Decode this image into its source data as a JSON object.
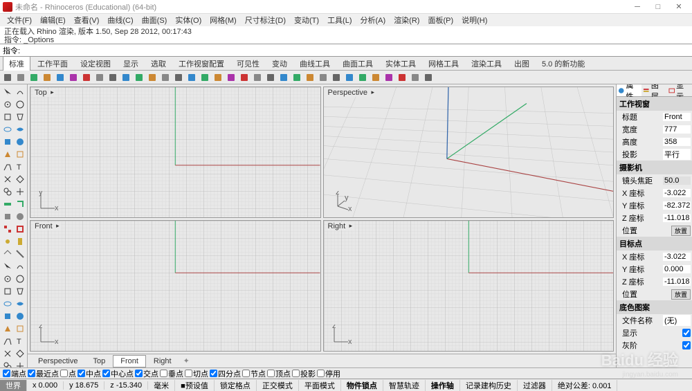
{
  "titlebar": {
    "title": "未命名 - Rhinoceros (Educational) (64-bit)"
  },
  "menubar": [
    "文件(F)",
    "编辑(E)",
    "查看(V)",
    "曲线(C)",
    "曲面(S)",
    "实体(O)",
    "网格(M)",
    "尺寸标注(D)",
    "变动(T)",
    "工具(L)",
    "分析(A)",
    "渲染(R)",
    "面板(P)",
    "说明(H)"
  ],
  "info": {
    "line1": "正在载入 Rhino 渲染, 版本 1.50, Sep 28 2012, 00:17:43",
    "line2": "指令: _Options"
  },
  "cmd": {
    "label": "指令:"
  },
  "tabs": [
    "标准",
    "工作平面",
    "设定视图",
    "显示",
    "选取",
    "工作视窗配置",
    "可见性",
    "变动",
    "曲线工具",
    "曲面工具",
    "实体工具",
    "网格工具",
    "渲染工具",
    "出图",
    "5.0 的新功能"
  ],
  "viewports": {
    "top": "Top",
    "persp": "Perspective",
    "front": "Front",
    "right": "Right"
  },
  "viewtabs": [
    "Perspective",
    "Top",
    "Front",
    "Right"
  ],
  "rpanel": {
    "tabs": [
      "属性",
      "图层",
      "显示"
    ],
    "sections": {
      "workview": "工作视窗",
      "camera": "摄影机",
      "target": "目标点",
      "wallpaper": "底色图案"
    },
    "props": {
      "title_l": "标题",
      "title_v": "Front",
      "width_l": "宽度",
      "width_v": "777",
      "height_l": "高度",
      "height_v": "358",
      "proj_l": "投影",
      "proj_v": "平行",
      "focal_l": "镜头焦距",
      "focal_v": "50.0",
      "cx_l": "X 座标",
      "cx_v": "-3.022",
      "cy_l": "Y 座标",
      "cy_v": "-82.372",
      "cz_l": "Z 座标",
      "cz_v": "-11.018",
      "pos_l": "位置",
      "pos_btn": "放置",
      "tx_l": "X 座标",
      "tx_v": "-3.022",
      "ty_l": "Y 座标",
      "ty_v": "0.000",
      "tz_l": "Z 座标",
      "tz_v": "-11.018",
      "tpos_l": "位置",
      "tpos_btn": "放置",
      "fname_l": "文件名称",
      "fname_v": "(无)",
      "show_l": "显示",
      "gray_l": "灰阶"
    }
  },
  "osnap": [
    {
      "l": "端点",
      "c": true
    },
    {
      "l": "最近点",
      "c": true
    },
    {
      "l": "点",
      "c": false
    },
    {
      "l": "中点",
      "c": true
    },
    {
      "l": "中心点",
      "c": true
    },
    {
      "l": "交点",
      "c": true
    },
    {
      "l": "垂点",
      "c": false
    },
    {
      "l": "切点",
      "c": false
    },
    {
      "l": "四分点",
      "c": true
    },
    {
      "l": "节点",
      "c": false
    },
    {
      "l": "顶点",
      "c": false
    },
    {
      "l": "投影",
      "c": false
    },
    {
      "l": "停用",
      "c": false
    }
  ],
  "status": {
    "world": "世界",
    "x": "x 0.000",
    "y": "y 18.675",
    "z": "z -15.340",
    "unit": "毫米",
    "default": "■预设值",
    "snap": "锁定格点",
    "ortho": "正交模式",
    "planar": "平面模式",
    "osnap": "物件锁点",
    "smart": "智慧轨迹",
    "gumball": "操作轴",
    "history": "记录建构历史",
    "filter": "过滤器",
    "tol": "绝对公差: 0.001"
  },
  "watermark": {
    "main": "Baidu 经验",
    "sub": "jingyan.baidu.com"
  }
}
